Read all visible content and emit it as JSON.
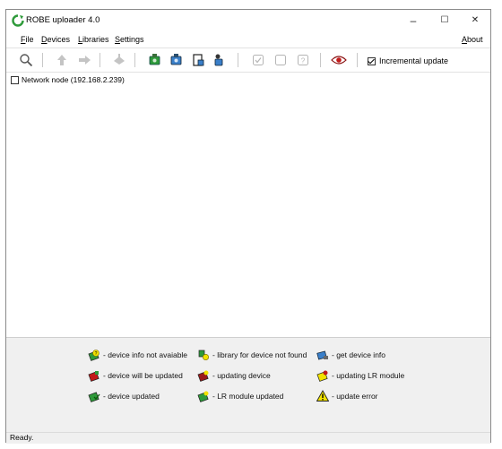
{
  "window": {
    "title": "ROBE uploader 4.0"
  },
  "window_controls": {
    "minimize": "–",
    "maximize": "☐",
    "close": "✕"
  },
  "menu": {
    "file_u": "F",
    "file_rest": "ile",
    "devices_u": "D",
    "devices_rest": "evices",
    "libraries_u": "L",
    "libraries_rest": "ibraries",
    "settings_u": "S",
    "settings_rest": "ettings",
    "about_u": "A",
    "about_rest": "bout"
  },
  "toolbar": {
    "incremental_label": "Incremental update",
    "incremental_checked": true,
    "icons": [
      "search-icon",
      "upload-disabled-icon",
      "download-disabled-icon",
      "erase-disabled-icon",
      "device-green-icon",
      "device-blue-icon",
      "device-page-icon",
      "device-user-icon",
      "check-disabled-icon",
      "square-disabled-icon",
      "help-disabled-icon",
      "eye-icon"
    ]
  },
  "tree": {
    "root_label": "Network node (192.168.2.239)",
    "root_checked": false
  },
  "legend": [
    {
      "icon": "device-info-unavailable-icon",
      "label": "- device info not avaiable"
    },
    {
      "icon": "library-not-found-icon",
      "label": "- library for device not found"
    },
    {
      "icon": "get-device-info-icon",
      "label": "- get device info"
    },
    {
      "icon": "device-will-update-icon",
      "label": "- device will be updated"
    },
    {
      "icon": "updating-device-icon",
      "label": "- updating device"
    },
    {
      "icon": "updating-lr-module-icon",
      "label": "- updating LR module"
    },
    {
      "icon": "device-updated-icon",
      "label": "- device updated"
    },
    {
      "icon": "lr-module-updated-icon",
      "label": "- LR module updated"
    },
    {
      "icon": "update-error-icon",
      "label": "- update error"
    }
  ],
  "status": {
    "text": "Ready."
  },
  "colors": {
    "accent_green": "#2e9a3a",
    "menu_bg": "#ffffff",
    "legend_bg": "#f0f0f0",
    "update_error": "#f2e200"
  }
}
